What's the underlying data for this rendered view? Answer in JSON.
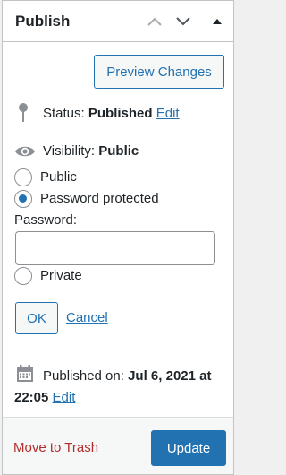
{
  "header": {
    "title": "Publish",
    "move_up_icon": "chevron-up-icon",
    "move_down_icon": "chevron-down-icon",
    "toggle_icon": "triangle-up-icon"
  },
  "preview_button": "Preview Changes",
  "status": {
    "icon": "pin-icon",
    "label": "Status:",
    "value": "Published",
    "edit": "Edit"
  },
  "visibility": {
    "icon": "eye-icon",
    "label": "Visibility:",
    "value": "Public",
    "options": [
      {
        "label": "Public",
        "checked": false
      },
      {
        "label": "Password protected",
        "checked": true
      },
      {
        "label": "Private",
        "checked": false
      }
    ],
    "password_label": "Password:",
    "password_value": "",
    "ok": "OK",
    "cancel": "Cancel"
  },
  "published": {
    "icon": "calendar-icon",
    "label": "Published on:",
    "date": "Jul 6, 2021 at",
    "time": "22:05",
    "edit": "Edit"
  },
  "footer": {
    "trash": "Move to Trash",
    "update": "Update"
  },
  "colors": {
    "accent": "#2271b1",
    "danger": "#b32d2e",
    "text": "#1d2327",
    "icon": "#8c8f94"
  }
}
